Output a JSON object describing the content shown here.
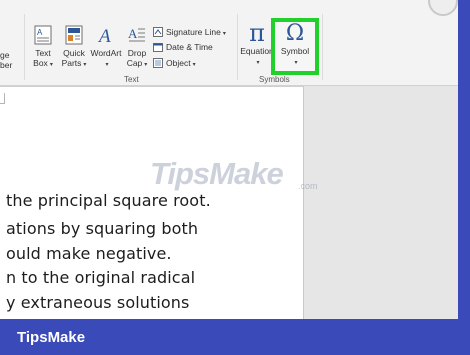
{
  "ribbon": {
    "partial_left_top": "ge",
    "partial_left_bottom": "ber",
    "text_box": {
      "line1": "Text",
      "line2": "Box"
    },
    "quick_parts": {
      "line1": "Quick",
      "line2": "Parts"
    },
    "wordart": {
      "line1": "WordArt"
    },
    "drop_cap": {
      "line1": "Drop",
      "line2": "Cap"
    },
    "signature_line": "Signature Line",
    "date_time": "Date & Time",
    "object": "Object",
    "text_group_label": "Text",
    "equation": {
      "line1": "Equation",
      "glyph": "π"
    },
    "symbol": {
      "line1": "Symbol",
      "glyph": "Ω"
    },
    "symbols_group_label": "Symbols"
  },
  "document": {
    "lines": [
      "the principal square root.",
      "ations by squaring both",
      "ould make      negative.",
      "n to the original radical",
      "y extraneous solutions"
    ]
  },
  "watermark": {
    "text": "TipsMake",
    "suffix": ".com"
  },
  "footer": {
    "brand": "TipsMake"
  },
  "colors": {
    "highlight": "#21d02a",
    "background": "#3a4ab8"
  }
}
